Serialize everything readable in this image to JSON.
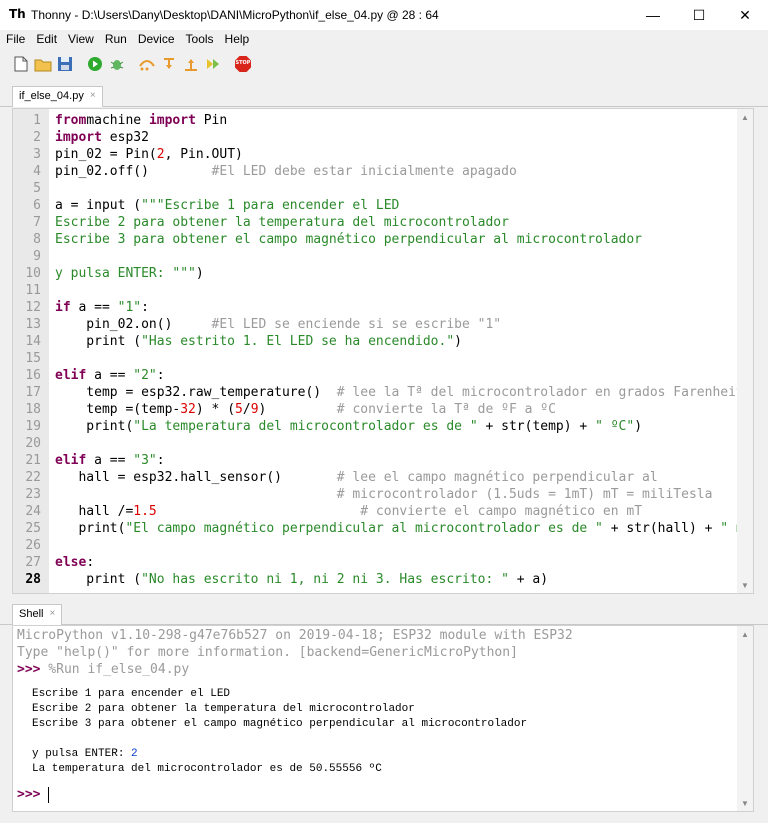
{
  "window": {
    "title": "Thonny  -  D:\\Users\\Dany\\Desktop\\DANI\\MicroPython\\if_else_04.py  @  28 : 64",
    "minimize": "—",
    "maximize": "☐",
    "close": "✕"
  },
  "menu": [
    "File",
    "Edit",
    "View",
    "Run",
    "Device",
    "Tools",
    "Help"
  ],
  "toolbar": {
    "icons": [
      "new-file-icon",
      "open-folder-icon",
      "save-icon",
      "run-icon",
      "debug-icon",
      "step-over-icon",
      "step-into-icon",
      "step-out-icon",
      "resume-icon",
      "stop-icon"
    ],
    "stop_label": "STOP",
    "colors": {
      "run": "#2eaa2e",
      "stop": "#d9261c"
    }
  },
  "editor_tab": {
    "label": "if_else_04.py",
    "close": "×"
  },
  "shell_tab": {
    "label": "Shell",
    "close": "×"
  },
  "code": {
    "line_numbers": [
      "1",
      "2",
      "3",
      "4",
      "5",
      "6",
      "7",
      "8",
      "9",
      "10",
      "11",
      "12",
      "13",
      "14",
      "15",
      "16",
      "17",
      "18",
      "19",
      "20",
      "21",
      "22",
      "23",
      "24",
      "25",
      "26",
      "27",
      "28"
    ],
    "current_line": "28",
    "lines": [
      [
        [
          "kw",
          "from"
        ],
        [
          "",
          "machine "
        ],
        [
          "kw",
          "import"
        ],
        [
          "",
          " Pin"
        ]
      ],
      [
        [
          "kw",
          "import"
        ],
        [
          "",
          " esp32"
        ]
      ],
      [
        [
          "",
          "pin_02 = Pin("
        ],
        [
          "num",
          "2"
        ],
        [
          "",
          ", Pin.OUT)"
        ]
      ],
      [
        [
          "",
          "pin_02.off()        "
        ],
        [
          "cmt",
          "#El LED debe estar inicialmente apagado"
        ]
      ],
      [],
      [
        [
          "",
          "a = input ("
        ],
        [
          "str",
          "\"\"\"Escribe 1 para encender el LED"
        ]
      ],
      [
        [
          "str",
          "Escribe 2 para obtener la temperatura del microcontrolador"
        ]
      ],
      [
        [
          "str",
          "Escribe 3 para obtener el campo magnético perpendicular al microcontrolador"
        ]
      ],
      [],
      [
        [
          "str",
          "y pulsa ENTER: \"\"\""
        ],
        [
          "",
          ")"
        ]
      ],
      [],
      [
        [
          "kw",
          "if"
        ],
        [
          "",
          " a == "
        ],
        [
          "str",
          "\"1\""
        ],
        [
          "",
          ":"
        ]
      ],
      [
        [
          "",
          "    pin_02.on()     "
        ],
        [
          "cmt",
          "#El LED se enciende si se escribe \"1\""
        ]
      ],
      [
        [
          "",
          "    print ("
        ],
        [
          "str",
          "\"Has estrito 1. El LED se ha encendido.\""
        ],
        [
          "",
          ")"
        ]
      ],
      [],
      [
        [
          "kw",
          "elif"
        ],
        [
          "",
          " a == "
        ],
        [
          "str",
          "\"2\""
        ],
        [
          "",
          ":"
        ]
      ],
      [
        [
          "",
          "    temp = esp32.raw_temperature()  "
        ],
        [
          "cmt",
          "# lee la Tª del microcontrolador en grados Farenheit"
        ]
      ],
      [
        [
          "",
          "    temp =(temp-"
        ],
        [
          "num",
          "32"
        ],
        [
          "",
          ") * ("
        ],
        [
          "num",
          "5"
        ],
        [
          "",
          "/"
        ],
        [
          "num",
          "9"
        ],
        [
          "",
          ")         "
        ],
        [
          "cmt",
          "# convierte la Tª de ºF a ºC"
        ]
      ],
      [
        [
          "",
          "    print("
        ],
        [
          "str",
          "\"La temperatura del microcontrolador es de \""
        ],
        [
          "",
          " + str(temp) + "
        ],
        [
          "str",
          "\" ºC\""
        ],
        [
          "",
          ")"
        ]
      ],
      [],
      [
        [
          "kw",
          "elif"
        ],
        [
          "",
          " a == "
        ],
        [
          "str",
          "\"3\""
        ],
        [
          "",
          ":"
        ]
      ],
      [
        [
          "",
          "   hall = esp32.hall_sensor()       "
        ],
        [
          "cmt",
          "# lee el campo magnético perpendicular al"
        ]
      ],
      [
        [
          "",
          "                                    "
        ],
        [
          "cmt",
          "# microcontrolador (1.5uds = 1mT) mT = miliTesla"
        ]
      ],
      [
        [
          "",
          "   hall /="
        ],
        [
          "num",
          "1.5"
        ],
        [
          "",
          "                          "
        ],
        [
          "cmt",
          "# convierte el campo magnético en mT"
        ]
      ],
      [
        [
          "",
          "   print("
        ],
        [
          "str",
          "\"El campo magnético perpendicular al microcontrolador es de \""
        ],
        [
          "",
          " + str(hall) + "
        ],
        [
          "str",
          "\" mT\""
        ]
      ],
      [],
      [
        [
          "kw",
          "else"
        ],
        [
          "",
          ":"
        ]
      ],
      [
        [
          "",
          "    print ("
        ],
        [
          "str",
          "\"No has escrito ni 1, ni 2 ni 3. Has escrito: \""
        ],
        [
          "",
          " + a)"
        ]
      ]
    ]
  },
  "shell": {
    "banner1": "MicroPython v1.10-298-g47e76b527 on 2019-04-18; ESP32 module with ESP32",
    "banner2": "Type \"help()\" for more information. [backend=GenericMicroPython]",
    "prompt": ">>>",
    "run_command": " %Run if_else_04.py",
    "output": [
      "Escribe 1 para encender el LED",
      "Escribe 2 para obtener la temperatura del microcontrolador",
      "Escribe 3 para obtener el campo magnético perpendicular al microcontrolador",
      "",
      "y pulsa ENTER: ",
      "La temperatura del microcontrolador es de 50.55556 ºC"
    ],
    "user_input": "2",
    "final_prompt": ">>>"
  }
}
